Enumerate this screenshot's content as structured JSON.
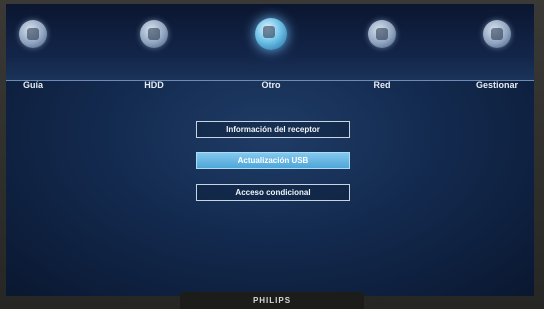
{
  "menu": {
    "items": [
      {
        "label": "Guía",
        "icon": "guide-icon"
      },
      {
        "label": "HDD",
        "icon": "hdd-icon"
      },
      {
        "label": "Otro",
        "icon": "other-icon"
      },
      {
        "label": "Red",
        "icon": "network-icon"
      },
      {
        "label": "Gestionar",
        "icon": "manage-icon"
      }
    ],
    "active": "Otro"
  },
  "submenu": {
    "items": [
      {
        "label": "Información del receptor"
      },
      {
        "label": "Actualización USB"
      },
      {
        "label": "Acceso condicional"
      }
    ],
    "selected": "Actualización USB"
  },
  "monitor": {
    "brand": "PHILIPS"
  },
  "colors": {
    "accent": "#5bb3e3",
    "background": "#132a4f"
  }
}
